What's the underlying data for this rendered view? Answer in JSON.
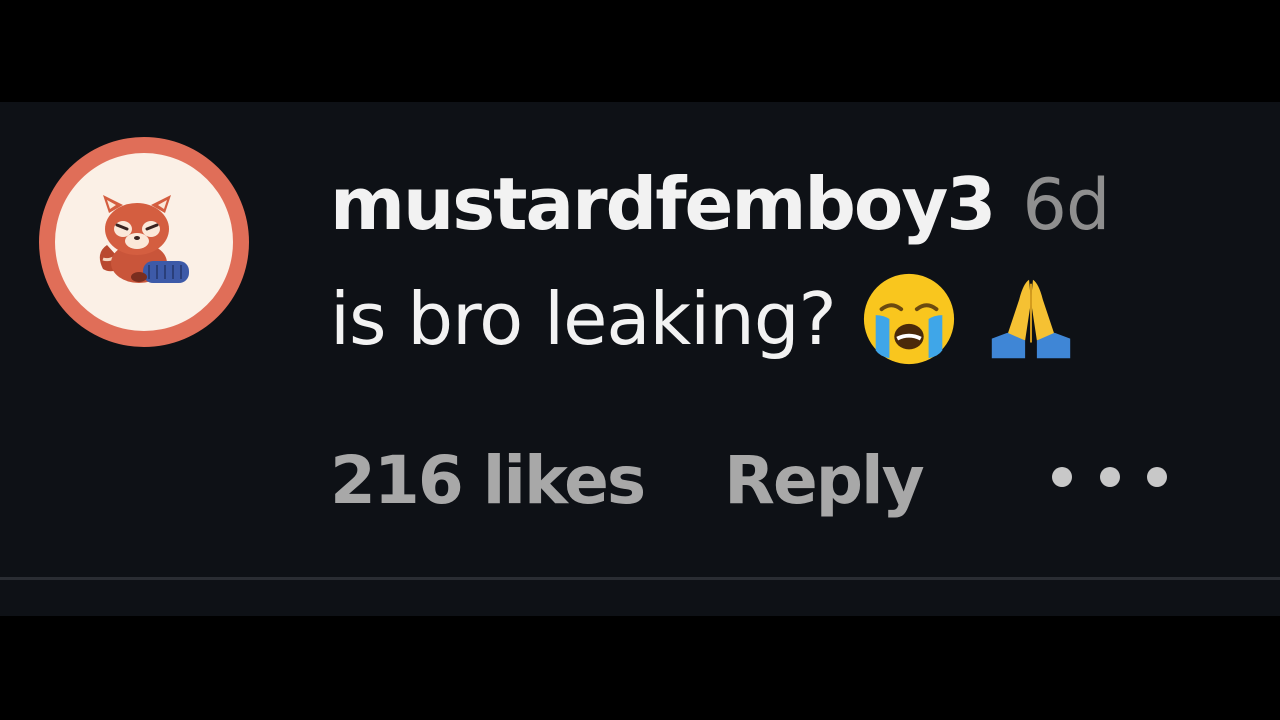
{
  "comment": {
    "username": "mustardfemboy3",
    "timestamp": "6d",
    "text": "is bro leaking?",
    "emojis": [
      "loudly-crying-face",
      "folded-hands"
    ],
    "likes_label": "216 likes",
    "reply_label": "Reply",
    "more_icon": "more-options-icon"
  },
  "colors": {
    "background": "#0e1116",
    "avatar_ring": "#e06e58",
    "username": "#f2f2f2",
    "secondary_text": "#a8a8a8",
    "timestamp": "#8f8f8f"
  }
}
